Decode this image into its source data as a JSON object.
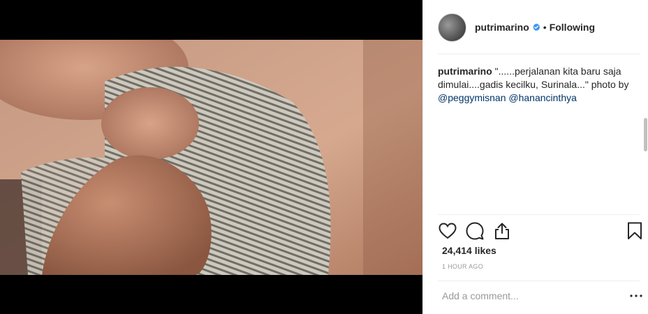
{
  "post": {
    "media_alt": "",
    "header": {
      "username": "putrimarino",
      "separator": "•",
      "follow_status": "Following"
    },
    "caption": {
      "username": "putrimarino",
      "text": "\"......perjalanan kita baru saja dimulai....gadis kecilku, Surinala...\" photo by",
      "mentions": [
        "@peggymisnan",
        "@hanancinthya"
      ]
    },
    "actions": {
      "icons": [
        "heart-icon",
        "comment-icon",
        "share-icon",
        "bookmark-icon"
      ]
    },
    "likes_text": "24,414 likes",
    "time_ago": "1 HOUR AGO",
    "comment": {
      "placeholder": "Add a comment...",
      "more_label": "•••"
    },
    "colors": {
      "verified": "#3897f0",
      "text": "#262626",
      "muted": "#999999",
      "mention": "#003569",
      "divider": "#efefef"
    }
  }
}
